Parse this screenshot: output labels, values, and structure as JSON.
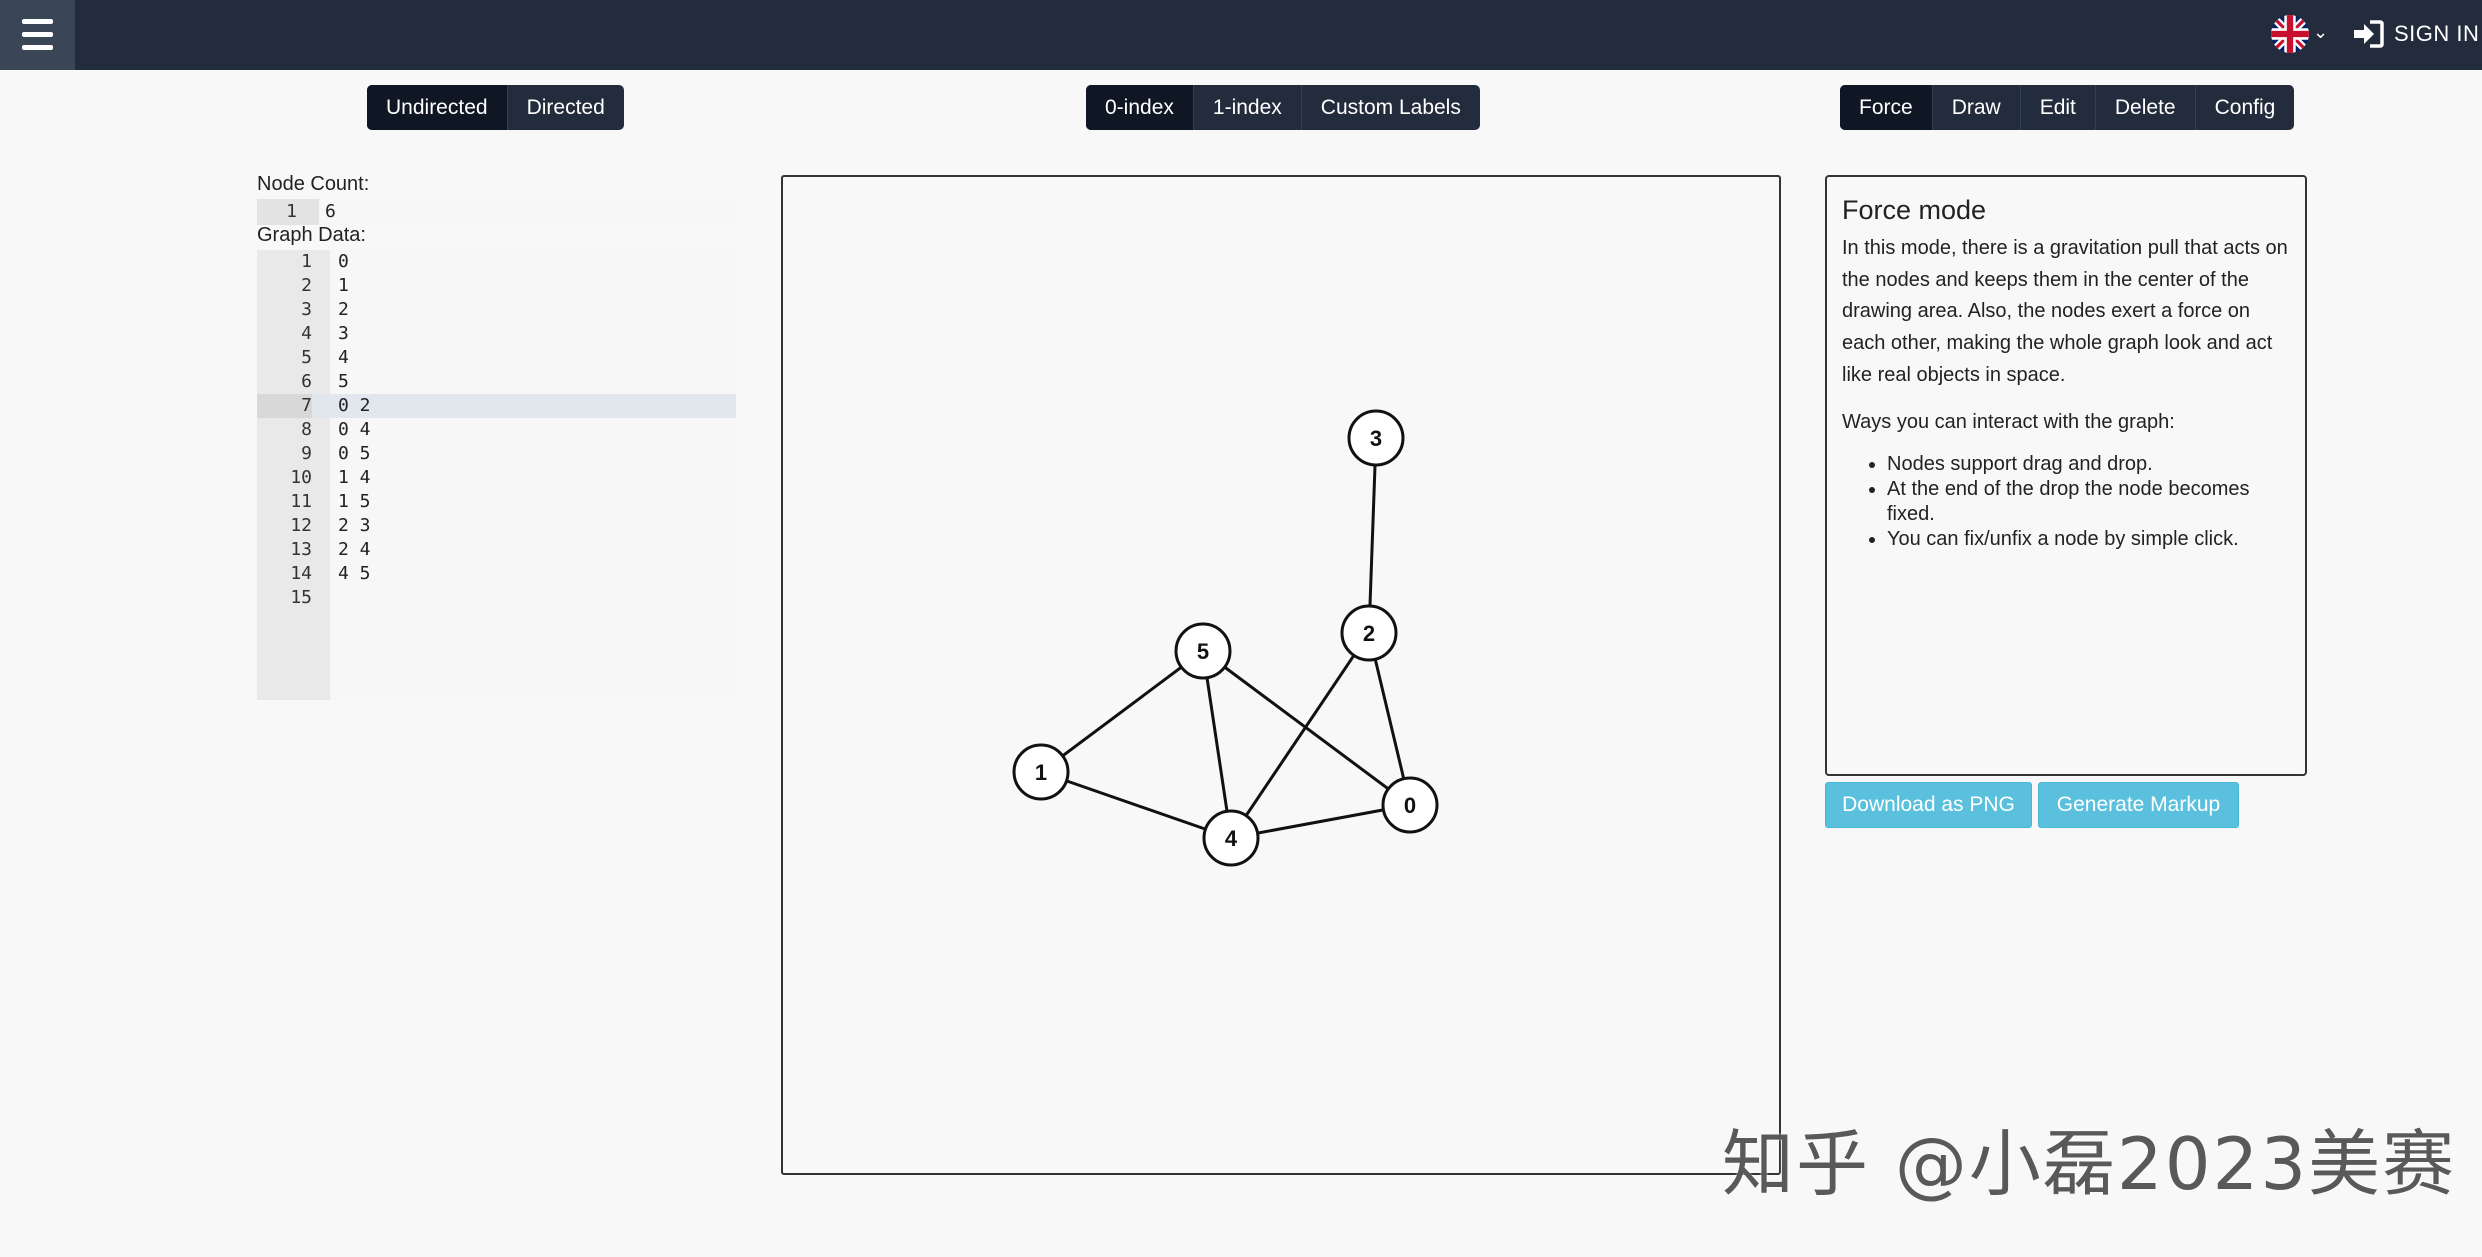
{
  "nav": {
    "sign_in": "SIGN IN"
  },
  "direction_group": [
    {
      "label": "Undirected",
      "active": true
    },
    {
      "label": "Directed",
      "active": false
    }
  ],
  "index_group": [
    {
      "label": "0-index",
      "active": true
    },
    {
      "label": "1-index",
      "active": false
    },
    {
      "label": "Custom Labels",
      "active": false
    }
  ],
  "mode_group": [
    {
      "label": "Force",
      "active": true
    },
    {
      "label": "Draw",
      "active": false
    },
    {
      "label": "Edit",
      "active": false
    },
    {
      "label": "Delete",
      "active": false
    },
    {
      "label": "Config",
      "active": false
    }
  ],
  "node_count": {
    "label": "Node Count:",
    "lines": [
      "6"
    ]
  },
  "graph_data": {
    "label": "Graph Data:",
    "lines": [
      "0",
      "1",
      "2",
      "3",
      "4",
      "5",
      "0 2",
      "0 4",
      "0 5",
      "1 4",
      "1 5",
      "2 3",
      "2 4",
      "4 5",
      ""
    ],
    "current_line": 7
  },
  "graph": {
    "nodes": [
      "0",
      "1",
      "2",
      "3",
      "4",
      "5"
    ],
    "edges": [
      [
        "0",
        "2"
      ],
      [
        "0",
        "4"
      ],
      [
        "0",
        "5"
      ],
      [
        "1",
        "4"
      ],
      [
        "1",
        "5"
      ],
      [
        "2",
        "3"
      ],
      [
        "2",
        "4"
      ],
      [
        "4",
        "5"
      ]
    ]
  },
  "info": {
    "title": "Force mode",
    "paragraph1": "In this mode, there is a gravitation pull that acts on the nodes and keeps them in the center of the drawing area. Also, the nodes exert a force on each other, making the whole graph look and act like real objects in space.",
    "paragraph2": "Ways you can interact with the graph:",
    "bullets": [
      "Nodes support drag and drop.",
      "At the end of the drop the node becomes fixed.",
      "You can fix/unfix a node by simple click."
    ]
  },
  "actions": {
    "download": "Download as PNG",
    "markup": "Generate Markup"
  },
  "watermark": "知乎 @小磊2023美赛",
  "colors": {
    "nav_bg": "#222c3c",
    "button_dark": "#222c3c",
    "button_active": "#0f1724",
    "action_blue": "#5bc0de"
  }
}
